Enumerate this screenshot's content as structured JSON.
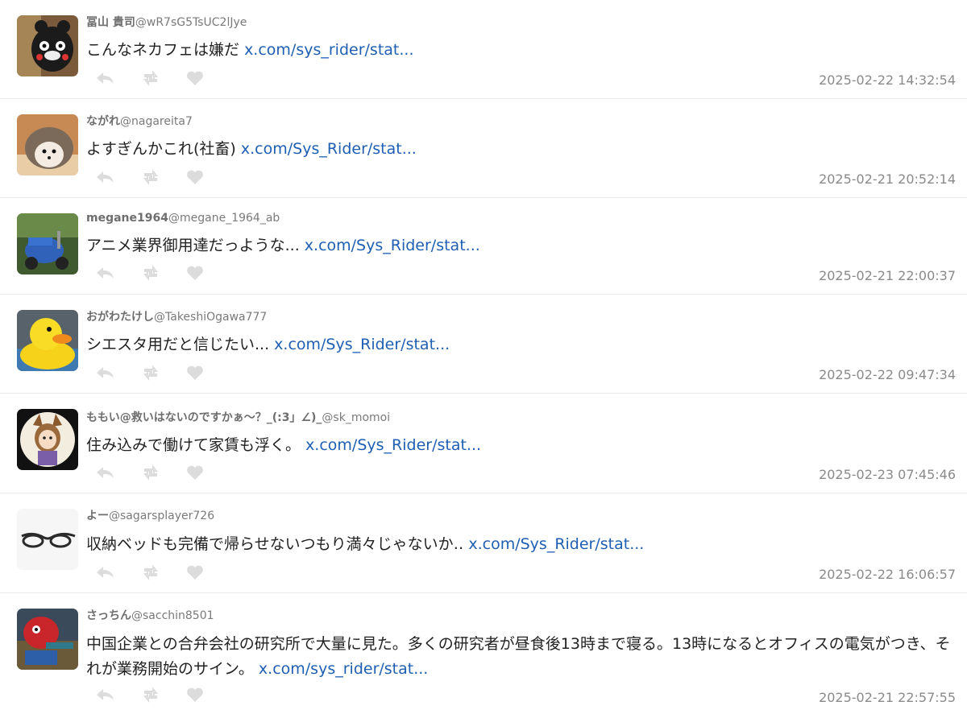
{
  "tweets": [
    {
      "name": "冨山 貴司",
      "handle": "@wR7sG5TsUC2lJye",
      "text": "こんなネカフェは嫌だ",
      "link": "x.com/sys_rider/stat...",
      "time": "2025-02-22 14:32:54",
      "avatar": "kumamon-avatar"
    },
    {
      "name": "ながれ",
      "handle": "@nagareita7",
      "text": "よすぎんかこれ(社畜)",
      "link": "x.com/Sys_Rider/stat...",
      "time": "2025-02-21 20:52:14",
      "avatar": "hedgehog-avatar"
    },
    {
      "name": "megane1964",
      "handle": "@megane_1964_ab",
      "text": "アニメ業界御用達だっような...",
      "link": "x.com/Sys_Rider/stat...",
      "time": "2025-02-21 22:00:37",
      "avatar": "scooter-avatar"
    },
    {
      "name": "おがわたけし",
      "handle": "@TakeshiOgawa777",
      "text": "シエスタ用だと信じたい...",
      "link": "x.com/Sys_Rider/stat...",
      "time": "2025-02-22 09:47:34",
      "avatar": "duck-avatar"
    },
    {
      "name": "ももい@救いはないのですかぁ～？_(:3」∠)_",
      "handle": "@sk_momoi",
      "text": "住み込みで働けて家賃も浮く。",
      "link": "x.com/Sys_Rider/stat...",
      "time": "2025-02-23 07:45:46",
      "avatar": "anime-girl-avatar"
    },
    {
      "name": "よー",
      "handle": "@sagarsplayer726",
      "text": "収納ベッドも完備で帰らせないつもり満々じゃないか‥",
      "link": "x.com/Sys_Rider/stat...",
      "time": "2025-02-22 16:06:57",
      "avatar": "glasses-avatar"
    },
    {
      "name": "さっちん",
      "handle": "@sacchin8501",
      "text": "中国企業との合弁会社の研究所で大量に見た。多くの研究者が昼食後13時まで寝る。13時になるとオフィスの電気がつき、それが業務開始のサイン。",
      "link": "x.com/sys_rider/stat...",
      "time": "2025-02-21 22:57:55",
      "avatar": "red-mascot-avatar"
    }
  ],
  "colors": {
    "link": "#1e5fb3",
    "meta": "#8a8a8a",
    "icon": "#dcdcdc"
  }
}
